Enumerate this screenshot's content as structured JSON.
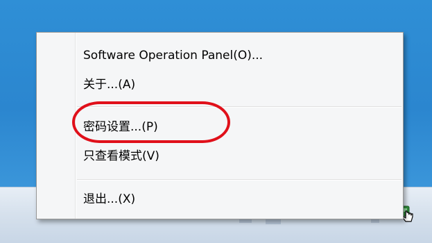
{
  "menu": {
    "items": [
      {
        "label": "Software Operation Panel(O)..."
      },
      {
        "label": "关于...(A)"
      },
      {
        "label": "密码设置...(P)"
      },
      {
        "label": "只查看模式(V)"
      },
      {
        "label": "退出...(X)"
      }
    ],
    "highlight_color": "#e0101a"
  },
  "tray": {
    "icon": "scanner-tray-icon",
    "cursor": "hand-pointer-icon"
  }
}
